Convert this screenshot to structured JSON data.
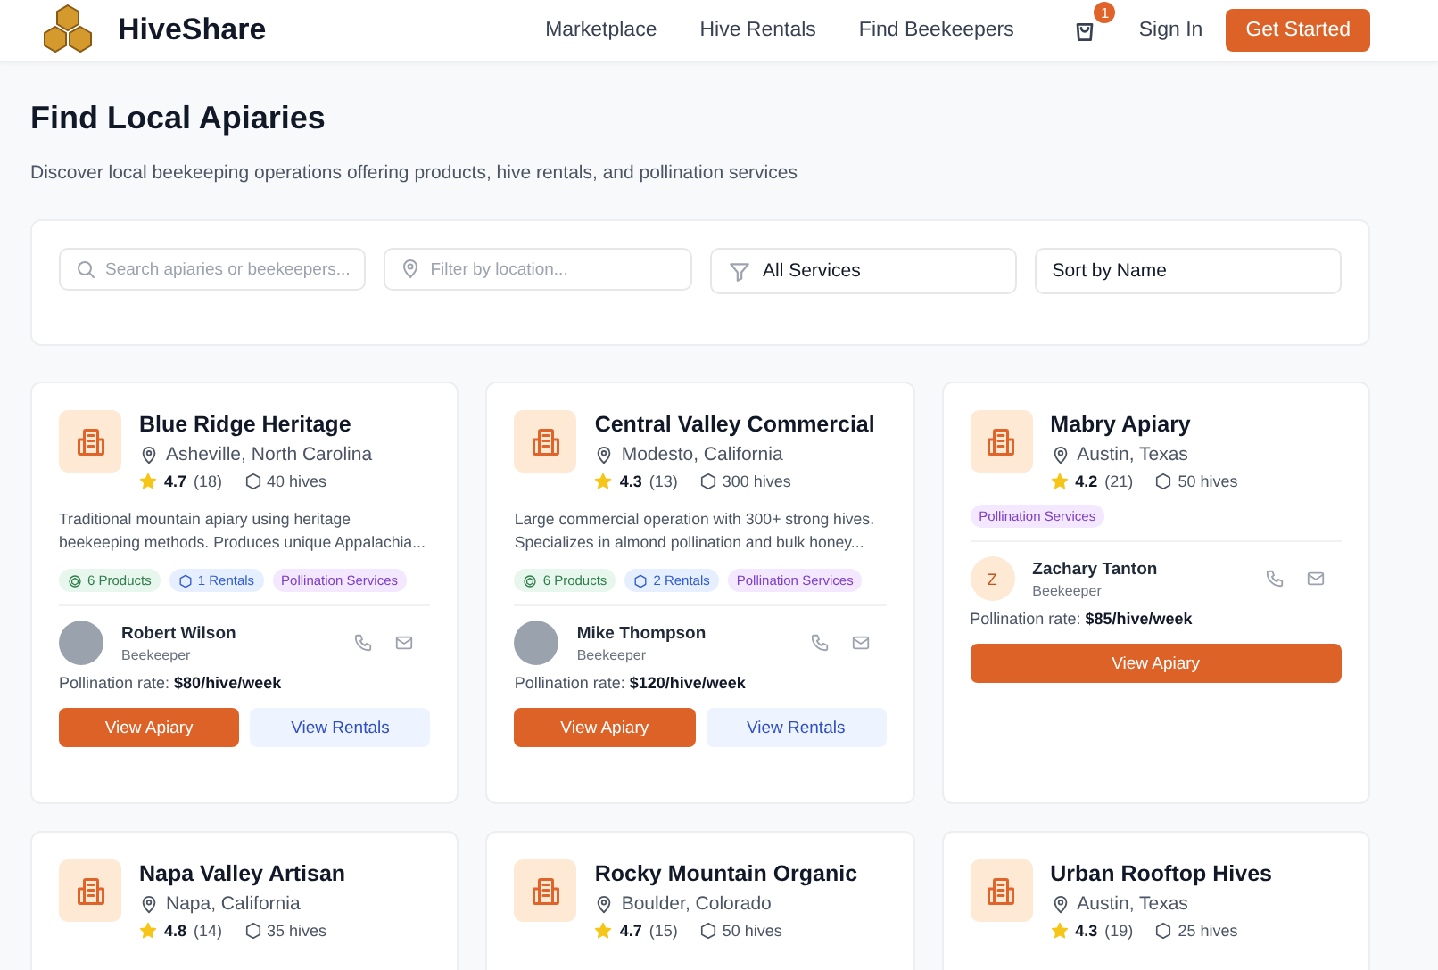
{
  "header": {
    "brand": "HiveShare",
    "nav": [
      "Marketplace",
      "Hive Rentals",
      "Find Beekeepers"
    ],
    "cart_count": "1",
    "sign_in": "Sign In",
    "cta": "Get Started"
  },
  "page": {
    "title": "Find Local Apiaries",
    "subtitle": "Discover local beekeeping operations offering products, hive rentals, and pollination services"
  },
  "filters": {
    "search": {
      "placeholder": "Search apiaries or beekeepers..."
    },
    "location": {
      "placeholder": "Filter by location..."
    },
    "services": {
      "value": "All Services"
    },
    "sort": {
      "value": "Sort by Name"
    }
  },
  "apiaries": [
    {
      "name": "Blue Ridge Heritage",
      "location": "Asheville, North Carolina",
      "rating": "4.7",
      "reviews": "(18)",
      "hives": "40 hives",
      "description": "Traditional mountain apiary using heritage beekeeping methods. Produces unique Appalachia...",
      "tags": [
        {
          "kind": "products",
          "label": "6 Products"
        },
        {
          "kind": "rentals",
          "label": "1 Rentals"
        },
        {
          "kind": "pollination",
          "label": "Pollination Services"
        }
      ],
      "keeper": {
        "name": "Robert Wilson",
        "role": "Beekeeper"
      },
      "rate_label": "Pollination rate:",
      "rate": "$80/hive/week",
      "buttons": [
        {
          "kind": "primary",
          "label": "View Apiary"
        },
        {
          "kind": "secondary",
          "label": "View Rentals"
        }
      ]
    },
    {
      "name": "Central Valley Commercial",
      "location": "Modesto, California",
      "rating": "4.3",
      "reviews": "(13)",
      "hives": "300 hives",
      "description": "Large commercial operation with 300+ strong hives. Specializes in almond pollination and bulk honey...",
      "tags": [
        {
          "kind": "products",
          "label": "6 Products"
        },
        {
          "kind": "rentals",
          "label": "2 Rentals"
        },
        {
          "kind": "pollination",
          "label": "Pollination Services"
        }
      ],
      "keeper": {
        "name": "Mike Thompson",
        "role": "Beekeeper"
      },
      "rate_label": "Pollination rate:",
      "rate": "$120/hive/week",
      "buttons": [
        {
          "kind": "primary",
          "label": "View Apiary"
        },
        {
          "kind": "secondary",
          "label": "View Rentals"
        }
      ]
    },
    {
      "name": "Mabry Apiary",
      "location": "Austin, Texas",
      "rating": "4.2",
      "reviews": "(21)",
      "hives": "50 hives",
      "tags": [
        {
          "kind": "pollination",
          "label": "Pollination Services"
        }
      ],
      "keeper": {
        "name": "Zachary Tanton",
        "role": "Beekeeper",
        "initial": "Z"
      },
      "rate_label": "Pollination rate:",
      "rate": "$85/hive/week",
      "buttons": [
        {
          "kind": "primary",
          "label": "View Apiary"
        }
      ]
    },
    {
      "name": "Napa Valley Artisan",
      "location": "Napa, California",
      "rating": "4.8",
      "reviews": "(14)",
      "hives": "35 hives"
    },
    {
      "name": "Rocky Mountain Organic",
      "location": "Boulder, Colorado",
      "rating": "4.7",
      "reviews": "(15)",
      "hives": "50 hives"
    },
    {
      "name": "Urban Rooftop Hives",
      "location": "Austin, Texas",
      "rating": "4.3",
      "reviews": "(19)",
      "hives": "25 hives"
    }
  ]
}
